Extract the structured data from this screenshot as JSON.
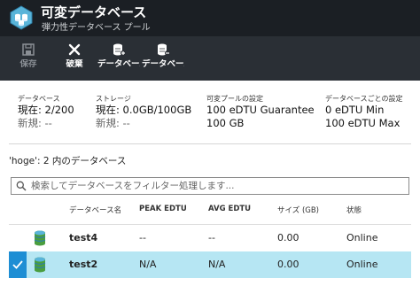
{
  "header": {
    "title": "可変データベース",
    "subtitle": "弾力性データベース プール",
    "icon": "elastic-pool-icon"
  },
  "toolbar": {
    "items": [
      {
        "label": "保存",
        "icon": "save-icon",
        "enabled": false
      },
      {
        "label": "破棄",
        "icon": "close-icon",
        "enabled": true
      },
      {
        "label": "データベースの追加...",
        "icon": "database-add-icon",
        "enabled": true
      },
      {
        "label": "データベースの削除...",
        "icon": "database-remove-icon",
        "enabled": true
      }
    ]
  },
  "stats": {
    "databases": {
      "heading": "データベース",
      "current": "現在: 2/200",
      "new": "新規: --"
    },
    "storage": {
      "heading": "ストレージ",
      "current": "現在: 0.0GB/100GB",
      "new": "新規: --"
    },
    "pool_settings": {
      "heading": "可変プールの設定",
      "line1": "100 eDTU Guarantee",
      "line2": "100 GB"
    },
    "per_db_settings": {
      "heading": "データベースごとの設定",
      "line1": "0 eDTU Min",
      "line2": "100 eDTU Max"
    }
  },
  "section_title": "'hoge': 2 内のデータベース",
  "search": {
    "placeholder": "検索してデータベースをフィルター処理します...",
    "value": ""
  },
  "table": {
    "columns": [
      "データベース名",
      "PEAK EDTU",
      "AVG EDTU",
      "サイズ (GB)",
      "状態"
    ],
    "rows": [
      {
        "name": "test4",
        "peak": "--",
        "avg": "--",
        "size": "0.00",
        "status": "Online",
        "selected": false
      },
      {
        "name": "test2",
        "peak": "N/A",
        "avg": "N/A",
        "size": "0.00",
        "status": "Online",
        "selected": true
      }
    ]
  },
  "colors": {
    "header_bg": "#1b1f24",
    "toolbar_bg": "#2a2f35",
    "selected_row": "#b6e6f3",
    "accent": "#1e8ed4"
  }
}
